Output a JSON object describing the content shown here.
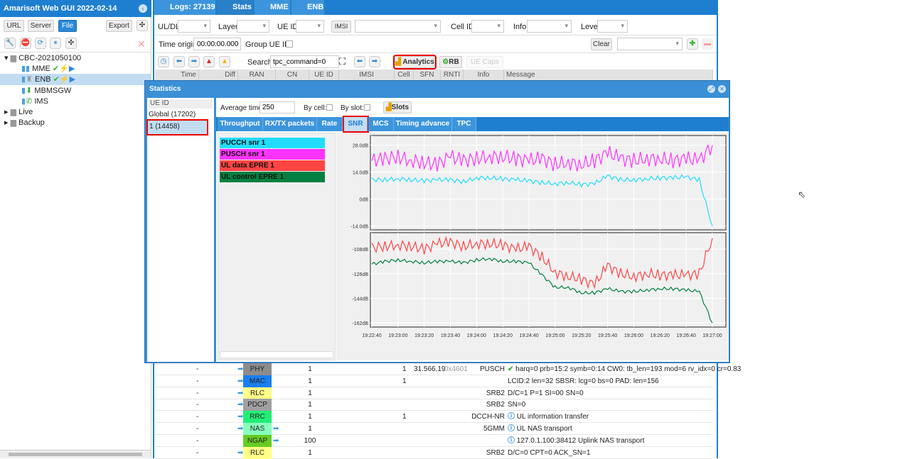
{
  "app": {
    "title": "Amarisoft Web GUI 2022-02-14"
  },
  "sidebar": {
    "buttons": [
      "URL",
      "Server",
      "File",
      "Export"
    ],
    "active": "File",
    "tree": [
      {
        "label": "CBC-2021050100",
        "level": 0
      },
      {
        "label": "MME",
        "level": 1
      },
      {
        "label": "ENB",
        "level": 1,
        "selected": true
      },
      {
        "label": "MBMSGW",
        "level": 1
      },
      {
        "label": "IMS",
        "level": 1
      },
      {
        "label": "Live",
        "level": 0
      },
      {
        "label": "Backup",
        "level": 0
      }
    ]
  },
  "tabs": [
    {
      "label": "Logs: 27139",
      "icon": "document-icon"
    },
    {
      "label": "Stats",
      "icon": "bar-chart-icon"
    },
    {
      "label": "MME",
      "icon": "server-icon"
    },
    {
      "label": "ENB",
      "icon": "antenna-icon"
    }
  ],
  "filters": {
    "uldl": "UL/DL",
    "layer": "Layer",
    "ueid": "UE ID",
    "imsi": "IMSI",
    "cellid": "Cell ID",
    "info": "Info",
    "level": "Level",
    "time_origin_label": "Time origin:",
    "time_origin": "00:00:00.000",
    "group_ue": "Group UE ID:",
    "clear": "Clear",
    "search_label": "Search",
    "search_value": "tpc_command=0",
    "analytics": "Analytics",
    "rb": "RB",
    "uecaps": "UE Caps"
  },
  "columns": [
    "Time",
    "Diff",
    "RAN",
    "CN",
    "UE ID",
    "IMSI",
    "Cell",
    "SFN",
    "RNTI",
    "Info",
    "Message"
  ],
  "stats": {
    "title": "Statistics",
    "ue_header": "UE ID",
    "ue_list": [
      "Global (17202)",
      "1 (14458)"
    ],
    "avg_label": "Average time:",
    "avg_value": "250",
    "by_cell": "By cell:",
    "by_slot": "By slot:",
    "slots": "Slots",
    "tabs": [
      "Throughput",
      "RX/TX packets",
      "Rate",
      "SNR",
      "MCS",
      "Timing advance",
      "TPC"
    ],
    "active_tab": "SNR"
  },
  "chart_data": [
    {
      "type": "line",
      "yticks": [
        "28.0dB",
        "14.0dB",
        "0dB",
        "-14.0dB"
      ],
      "ylim": [
        -14,
        28
      ],
      "grid": true,
      "x": [
        "19:22:40",
        "19:22:50",
        "19:23:00",
        "19:23:10",
        "19:23:20",
        "19:23:30",
        "19:23:40",
        "19:23:50",
        "19:24:00",
        "19:24:10",
        "19:24:20",
        "19:24:30",
        "19:24:40",
        "19:24:50",
        "19:25:00",
        "19:25:10",
        "19:25:20",
        "19:25:30",
        "19:25:40",
        "19:25:50",
        "19:26:00",
        "19:26:10",
        "19:26:20",
        "19:26:30",
        "19:26:40",
        "19:26:50",
        "19:27:00"
      ],
      "xticks": [
        "19:22:40",
        "19:23:00",
        "19:23:20",
        "19:23:40",
        "19:24:00",
        "19:24:20",
        "19:24:40",
        "19:25:00",
        "19:25:20",
        "19:25:40",
        "19:26:00",
        "19:26:20",
        "19:26:40",
        "19:27:00"
      ],
      "series": [
        {
          "name": "PUCCH snr 1",
          "color": "#22ddff",
          "values": [
            10,
            10,
            10.5,
            10,
            9.5,
            10,
            10,
            9,
            11,
            11,
            10.5,
            10,
            9.5,
            8.5,
            8,
            8.5,
            7.5,
            8,
            12,
            10,
            10,
            10.5,
            11,
            11,
            11.5,
            10,
            -14
          ]
        },
        {
          "name": "PUSCH snr 1",
          "color": "#ff33ff",
          "values": [
            20,
            21,
            22,
            20,
            19,
            18,
            22,
            20,
            21,
            22,
            22,
            21,
            20,
            21,
            18,
            19,
            18,
            20,
            24,
            21,
            20,
            21,
            21,
            20,
            21,
            20,
            28
          ]
        }
      ]
    },
    {
      "type": "line",
      "yticks": [
        "-108dB",
        "-126dB",
        "-144dB",
        "-162dB"
      ],
      "ylim": [
        -165,
        -96
      ],
      "grid": true,
      "series": [
        {
          "name": "UL data EPRE 1",
          "color": "#ff4444",
          "values": [
            -107,
            -106,
            -105,
            -106,
            -108,
            -104,
            -103,
            -106,
            -104,
            -104,
            -105,
            -108,
            -106,
            -114,
            -125,
            -128,
            -130,
            -134,
            -120,
            -126,
            -128,
            -126,
            -127,
            -127,
            -127,
            -126,
            -100
          ]
        },
        {
          "name": "UL control EPRE 1",
          "color": "#008040",
          "values": [
            -119,
            -117,
            -116,
            -117,
            -118,
            -117,
            -117,
            -118,
            -116,
            -115,
            -117,
            -117,
            -118,
            -127,
            -136,
            -136,
            -140,
            -140,
            -137,
            -139,
            -139,
            -138,
            -137,
            -137,
            -138,
            -139,
            -162
          ]
        }
      ]
    }
  ],
  "log_rows": [
    {
      "time": "-",
      "layer": "PHY",
      "color": "#8c8c8c",
      "ue": "1",
      "cell": "1",
      "sfn": "31.566.19",
      "rnti": "0x4601",
      "info": "PUSCH",
      "msg": "harq=0 prb=15:2 symb=0:14 CW0: tb_len=193 mod=6 rv_idx=0 cr=0.83",
      "icon": "ok"
    },
    {
      "time": "-",
      "layer": "MAC",
      "color": "#1a7ff0",
      "ue": "1",
      "cell": "1",
      "sfn": "",
      "rnti": "",
      "info": "",
      "msg": "LCID:2 len=32 SBSR: lcg=0 bs=0 PAD: len=156"
    },
    {
      "time": "-",
      "layer": "RLC",
      "color": "#ffff88",
      "ue": "1",
      "cell": "",
      "sfn": "",
      "rnti": "",
      "info": "SRB2",
      "msg": "D/C=1 P=1 SI=00 SN=0"
    },
    {
      "time": "-",
      "layer": "PDCP",
      "color": "#a0a0a0",
      "ue": "1",
      "cell": "",
      "sfn": "",
      "rnti": "",
      "info": "SRB2",
      "msg": "SN=0"
    },
    {
      "time": "-",
      "layer": "RRC",
      "color": "#22ee77",
      "ue": "1",
      "cell": "1",
      "sfn": "",
      "rnti": "",
      "info": "DCCH-NR",
      "msg": "UL information transfer",
      "icon": "info"
    },
    {
      "time": "-",
      "layer": "NAS",
      "color": "#88ffbb",
      "ue": "1",
      "cell": "",
      "sfn": "",
      "rnti": "",
      "info": "5GMM",
      "msg": "UL NAS transport",
      "icon": "info"
    },
    {
      "time": "-",
      "layer": "NGAP",
      "color": "#66cc22",
      "ue": "100",
      "cell": "",
      "sfn": "",
      "rnti": "",
      "info": "",
      "msg": "127.0.1.100:38412 Uplink NAS transport",
      "icon": "info"
    },
    {
      "time": "-",
      "layer": "RLC",
      "color": "#ffff88",
      "ue": "1",
      "cell": "",
      "sfn": "",
      "rnti": "",
      "info": "SRB2",
      "msg": "D/C=0 CPT=0 ACK_SN=1"
    }
  ]
}
